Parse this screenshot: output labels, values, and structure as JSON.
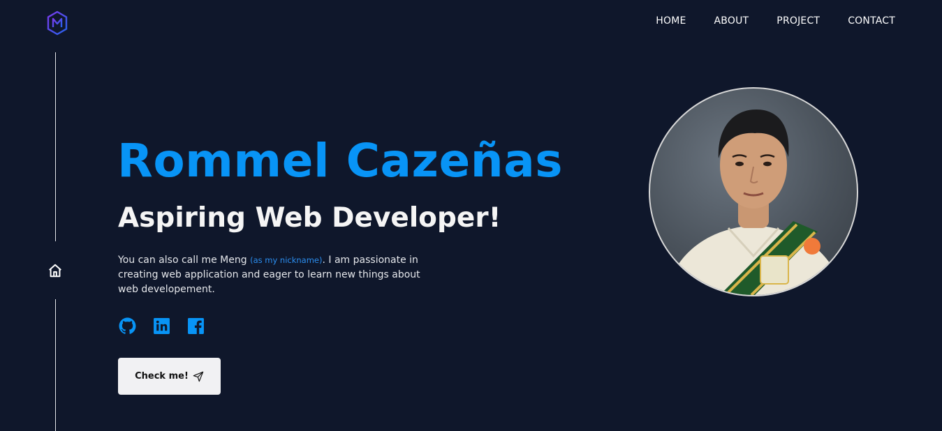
{
  "nav": {
    "items": [
      "HOME",
      "ABOUT",
      "PROJECT",
      "CONTACT"
    ]
  },
  "hero": {
    "name": "Rommel Cazeñas",
    "role": "Aspiring Web Developer!",
    "intro_before": "You can also call me Meng ",
    "intro_nickname": "(as my nickname)",
    "intro_after": ". I am passionate in creating web application and eager to learn new things about web developement.",
    "button_label": "Check me!"
  },
  "socials": [
    "github-icon",
    "linkedin-icon",
    "facebook-icon"
  ],
  "colors": {
    "background": "#0f172b",
    "accent": "#0894f6",
    "button_bg": "#f1f1f3"
  }
}
